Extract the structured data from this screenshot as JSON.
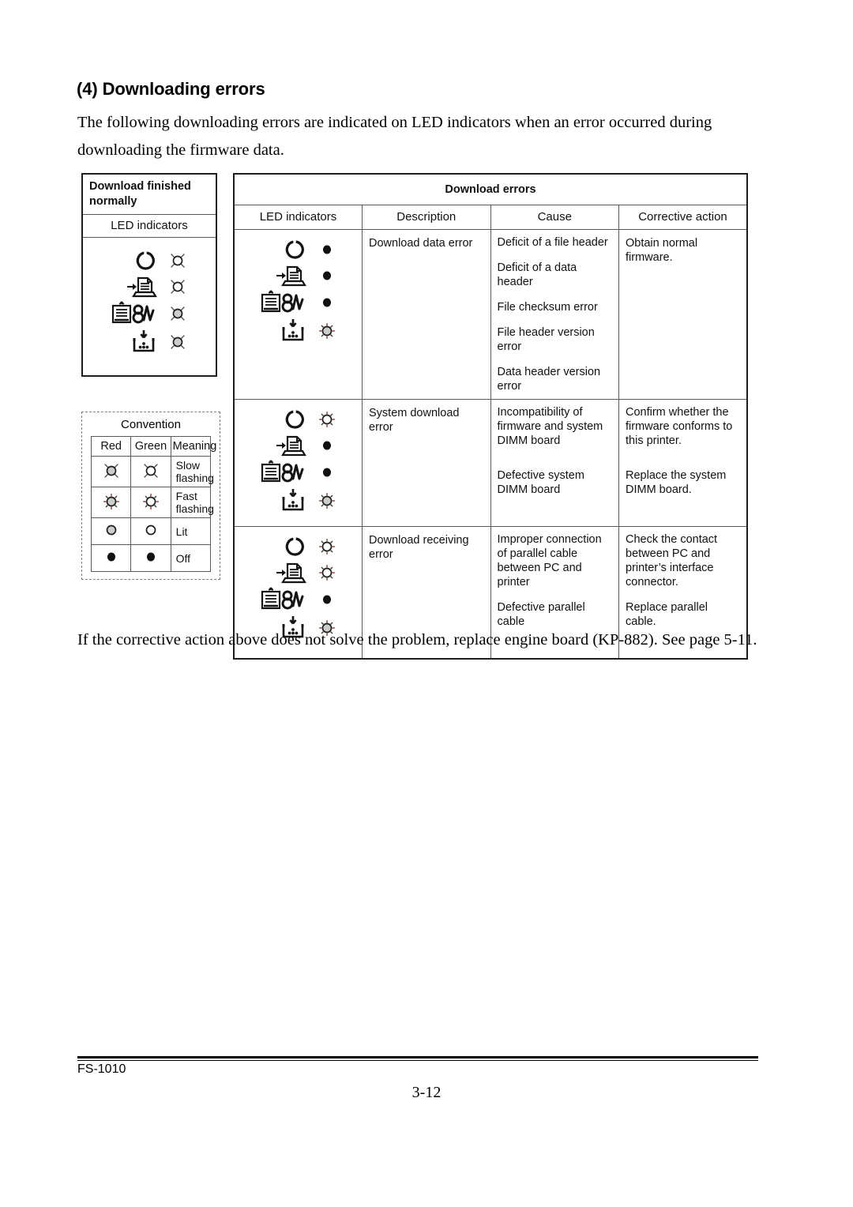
{
  "heading": "(4) Downloading errors",
  "intro_paragraph": "The following downloading errors are indicated on LED indicators when an error occurred during downloading the firmware data.",
  "closing_paragraph": "If the corrective action above does not solve the problem, replace engine board (KP-882). See page 5-11.",
  "normal_table": {
    "title": "Download finished normally",
    "column_header": "LED indicators",
    "leds": [
      {
        "indicator": "ready-icon",
        "state": "slow-flash-green"
      },
      {
        "indicator": "data-icon",
        "state": "slow-flash-green"
      },
      {
        "indicator": "attention-icon",
        "state": "slow-flash-red"
      },
      {
        "indicator": "toner-icon",
        "state": "slow-flash-red"
      }
    ]
  },
  "convention": {
    "title": "Convention",
    "headers": [
      "Red",
      "Green",
      "Meaning"
    ],
    "rows": [
      {
        "red": "slow-flash-red",
        "green": "slow-flash-green",
        "meaning": "Slow flashing"
      },
      {
        "red": "fast-flash-red",
        "green": "fast-flash-green",
        "meaning": "Fast flashing"
      },
      {
        "red": "lit-red",
        "green": "lit-green",
        "meaning": "Lit"
      },
      {
        "red": "off",
        "green": "off",
        "meaning": "Off"
      }
    ]
  },
  "errors_table": {
    "title": "Download errors",
    "headers": [
      "LED indicators",
      "Description",
      "Cause",
      "Corrective action"
    ],
    "rows": [
      {
        "leds": [
          {
            "indicator": "ready-icon",
            "state": "off"
          },
          {
            "indicator": "data-icon",
            "state": "off"
          },
          {
            "indicator": "attention-icon",
            "state": "off"
          },
          {
            "indicator": "toner-icon",
            "state": "fast-flash-red"
          }
        ],
        "description": "Download data error",
        "causes": [
          "Deficit of a file header",
          "Deficit of a data header",
          "File checksum error",
          "File header version error",
          "Data header version error"
        ],
        "actions": [
          "Obtain normal firmware."
        ]
      },
      {
        "leds": [
          {
            "indicator": "ready-icon",
            "state": "fast-flash-green"
          },
          {
            "indicator": "data-icon",
            "state": "off"
          },
          {
            "indicator": "attention-icon",
            "state": "off"
          },
          {
            "indicator": "toner-icon",
            "state": "fast-flash-red"
          }
        ],
        "description": "System download error",
        "causes": [
          "Incompatibility of firmware and system DIMM board",
          "Defective system DIMM board"
        ],
        "actions": [
          "Confirm whether the firmware conforms to this printer.",
          "Replace the system DIMM board."
        ]
      },
      {
        "leds": [
          {
            "indicator": "ready-icon",
            "state": "fast-flash-green"
          },
          {
            "indicator": "data-icon",
            "state": "fast-flash-green"
          },
          {
            "indicator": "attention-icon",
            "state": "off"
          },
          {
            "indicator": "toner-icon",
            "state": "fast-flash-red"
          }
        ],
        "description": "Download receiving error",
        "causes": [
          "Improper connection of parallel cable between PC and printer",
          "Defective parallel cable"
        ],
        "actions": [
          "Check the contact between PC and printer’s interface connector.",
          "Replace parallel cable."
        ]
      }
    ]
  },
  "footer": {
    "model": "FS-1010",
    "page_number": "3-12"
  },
  "colors": {
    "red_lamp_fill": "#cccccc",
    "green_lamp_fill": "#ffffff",
    "off_lamp_fill": "#111111",
    "rule": "#59595b"
  }
}
